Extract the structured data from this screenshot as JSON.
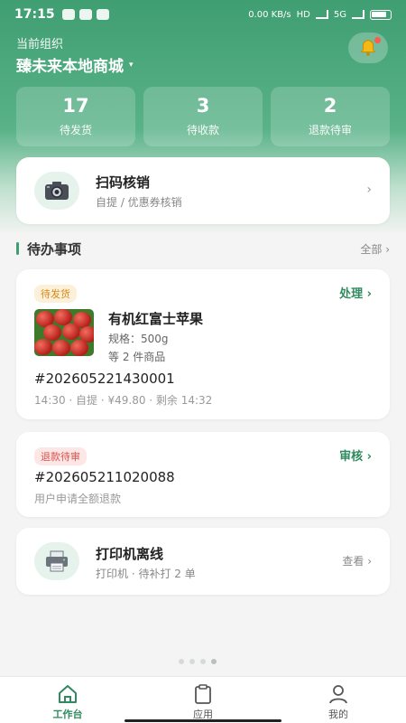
{
  "status_bar": {
    "time": "17:15",
    "network_speed": "0.00 KB/s",
    "signal_1": "HD",
    "signal_2": "5G"
  },
  "header": {
    "org_label": "当前组织",
    "org_name": "臻未来本地商城",
    "org_caret": "▾"
  },
  "stats": [
    {
      "value": "17",
      "label": "待发货"
    },
    {
      "value": "3",
      "label": "待收款"
    },
    {
      "value": "2",
      "label": "退款待审"
    }
  ],
  "scan": {
    "title": "扫码核销",
    "subtitle": "自提 / 优惠券核销",
    "chevron": "›"
  },
  "todo": {
    "title": "待办事项",
    "all_label": "全部 ›"
  },
  "order_task": {
    "tag": "待发货",
    "action": "处理 ›",
    "product_name": "有机红富士苹果",
    "spec": "规格：500g",
    "more_items": "等 2 件商品",
    "order_no": "#202605221430001",
    "meta": "14:30 · 自提 · ¥49.80 · 剩余 14:32"
  },
  "refund_task": {
    "tag": "退款待审",
    "action": "审核 ›",
    "order_no": "#202605211020088",
    "desc": "用户申请全额退款"
  },
  "printer_task": {
    "title": "打印机离线",
    "subtitle": "打印机 · 待补打 2 单",
    "action": "查看 ›"
  },
  "tabs": [
    {
      "label": "工作台",
      "icon": "home-icon",
      "active": true
    },
    {
      "label": "应用",
      "icon": "clipboard-icon",
      "active": false
    },
    {
      "label": "我的",
      "icon": "user-icon",
      "active": false
    }
  ],
  "colors": {
    "brand": "#3f9e72",
    "accent_orange": "#d58a1a",
    "accent_red": "#d9534f"
  }
}
